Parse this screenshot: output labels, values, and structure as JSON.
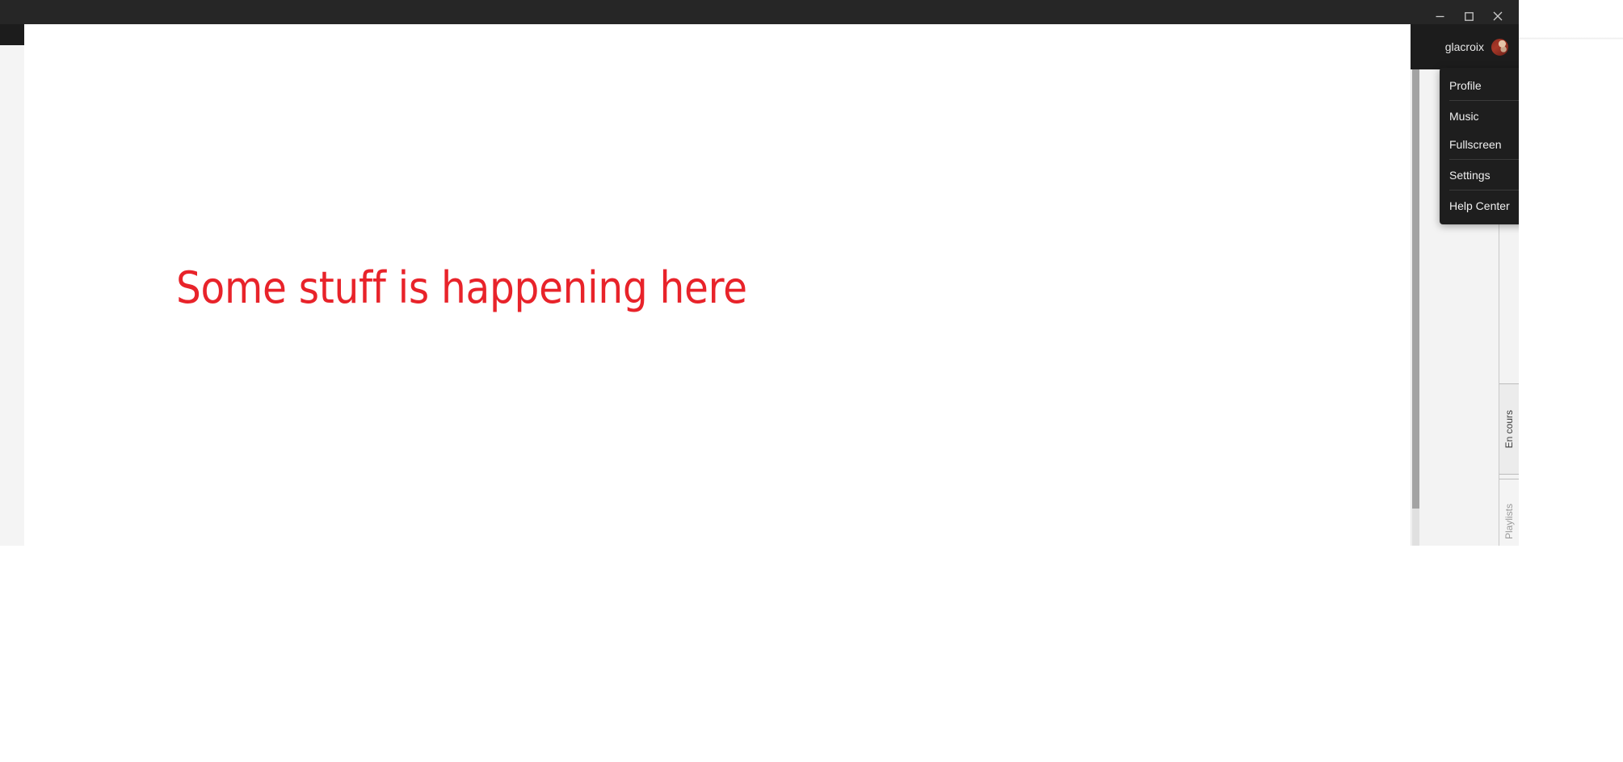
{
  "window": {
    "controls": [
      {
        "name": "minimize-button",
        "label": "Minimize",
        "glyph": "minimize-icon"
      },
      {
        "name": "maximize-button",
        "label": "Maximize",
        "glyph": "maximize-icon"
      },
      {
        "name": "close-button",
        "label": "Close",
        "glyph": "close-icon"
      }
    ]
  },
  "account": {
    "username": "glacroix",
    "avatar_icon": "user-avatar"
  },
  "dropdown": {
    "items": [
      {
        "label": "Profile",
        "separator_after": true
      },
      {
        "label": "Music",
        "separator_after": false
      },
      {
        "label": "Fullscreen",
        "separator_after": true
      },
      {
        "label": "Settings",
        "separator_after": true
      },
      {
        "label": "Help Center",
        "separator_after": false
      }
    ]
  },
  "main": {
    "headline": "Some stuff is happening here",
    "headline_color": "#e8232a"
  },
  "side_panel": {
    "tabs": [
      {
        "label": "En cours",
        "active": true
      },
      {
        "label": "Playlists",
        "active": false
      }
    ],
    "scrollbar": {
      "orientation": "vertical",
      "thumb_color": "#a3a3a3",
      "track_color": "#e0e0e0"
    }
  },
  "colors": {
    "titlebar": "#262626",
    "account_bar": "#1c1c1c",
    "menu_bg": "#1e1e1e",
    "panel_bg": "#f3f3f3",
    "accent_red": "#e8232a"
  }
}
